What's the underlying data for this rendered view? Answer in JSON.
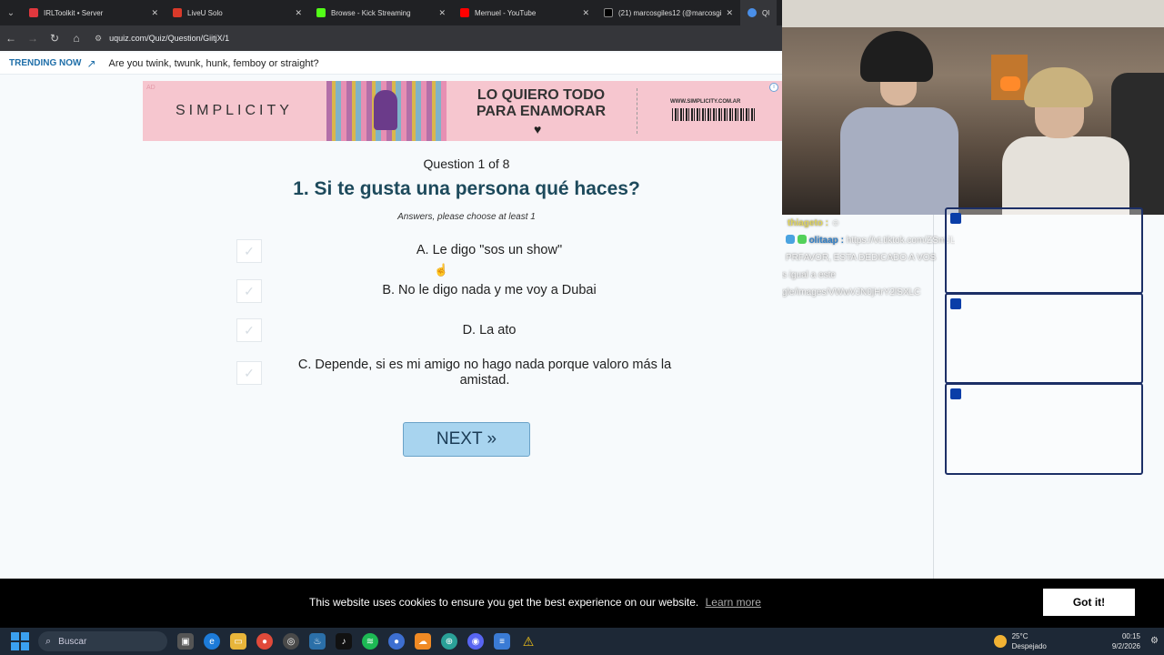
{
  "browser": {
    "tabs": [
      {
        "title": "IRLToolkit • Server",
        "color": "#e0383e"
      },
      {
        "title": "LiveU Solo",
        "color": "#d93a2a"
      },
      {
        "title": "Browse - Kick Streaming",
        "color": "#53fc18"
      },
      {
        "title": "Mernuel - YouTube",
        "color": "#ff0000"
      },
      {
        "title": "(21) marcosgiles12 (@marcosgi...",
        "color": "#000000"
      },
      {
        "title": "QUE",
        "color": "#4a8fe8"
      }
    ],
    "url": "uquiz.com/Quiz/Question/GiitjX/1"
  },
  "trending": {
    "label": "TRENDING NOW",
    "text": "Are you twink, twunk, hunk, femboy or straight?"
  },
  "ad": {
    "tag": "AD",
    "brand": "SIMPLICITY",
    "slogan_line1": "LO QUIERO TODO",
    "slogan_line2": "PARA ENAMORAR",
    "site": "WWW.SIMPLICITY.COM.AR",
    "info": "i"
  },
  "quiz": {
    "counter": "Question 1 of 8",
    "title": "1. Si te gusta una persona qué haces?",
    "hint": "Answers, please choose at least 1",
    "answers": [
      {
        "text": "A. Le digo \"sos un show\""
      },
      {
        "text": "B. No le digo nada y me voy a Dubai"
      },
      {
        "text": "D. La ato"
      },
      {
        "text": "C. Depende, si es mi amigo no hago nada porque valoro más la amistad."
      }
    ],
    "next_label": "NEXT »"
  },
  "cookie": {
    "message": "This website uses cookies to ensure you get the best experience on our website.",
    "learn_more": "Learn more",
    "accept": "Got it!"
  },
  "stream_chat": {
    "lines": [
      {
        "user": "thiageto :",
        "text": ""
      },
      {
        "user": "olitaap :",
        "text": "https://vt.tiktok.com/ZSmJLdETV/ MANU MIRA ESTO"
      },
      {
        "user": "",
        "text": "PRFAVOR, ESTA DEDICADO A VOS"
      },
      {
        "user": "",
        "text": "s igual a este"
      },
      {
        "user": "",
        "text": "gle/images/VWwVJN0jHrY2lSXLC"
      }
    ]
  },
  "taskbar": {
    "search_placeholder": "Buscar",
    "weather_temp": "25°C",
    "weather_desc": "Despejado",
    "time": "00:15",
    "date": "9/2/2026"
  },
  "colors": {
    "accent": "#1e6ea8",
    "title": "#1d4a5c",
    "next_button": "#a8d4ef"
  }
}
